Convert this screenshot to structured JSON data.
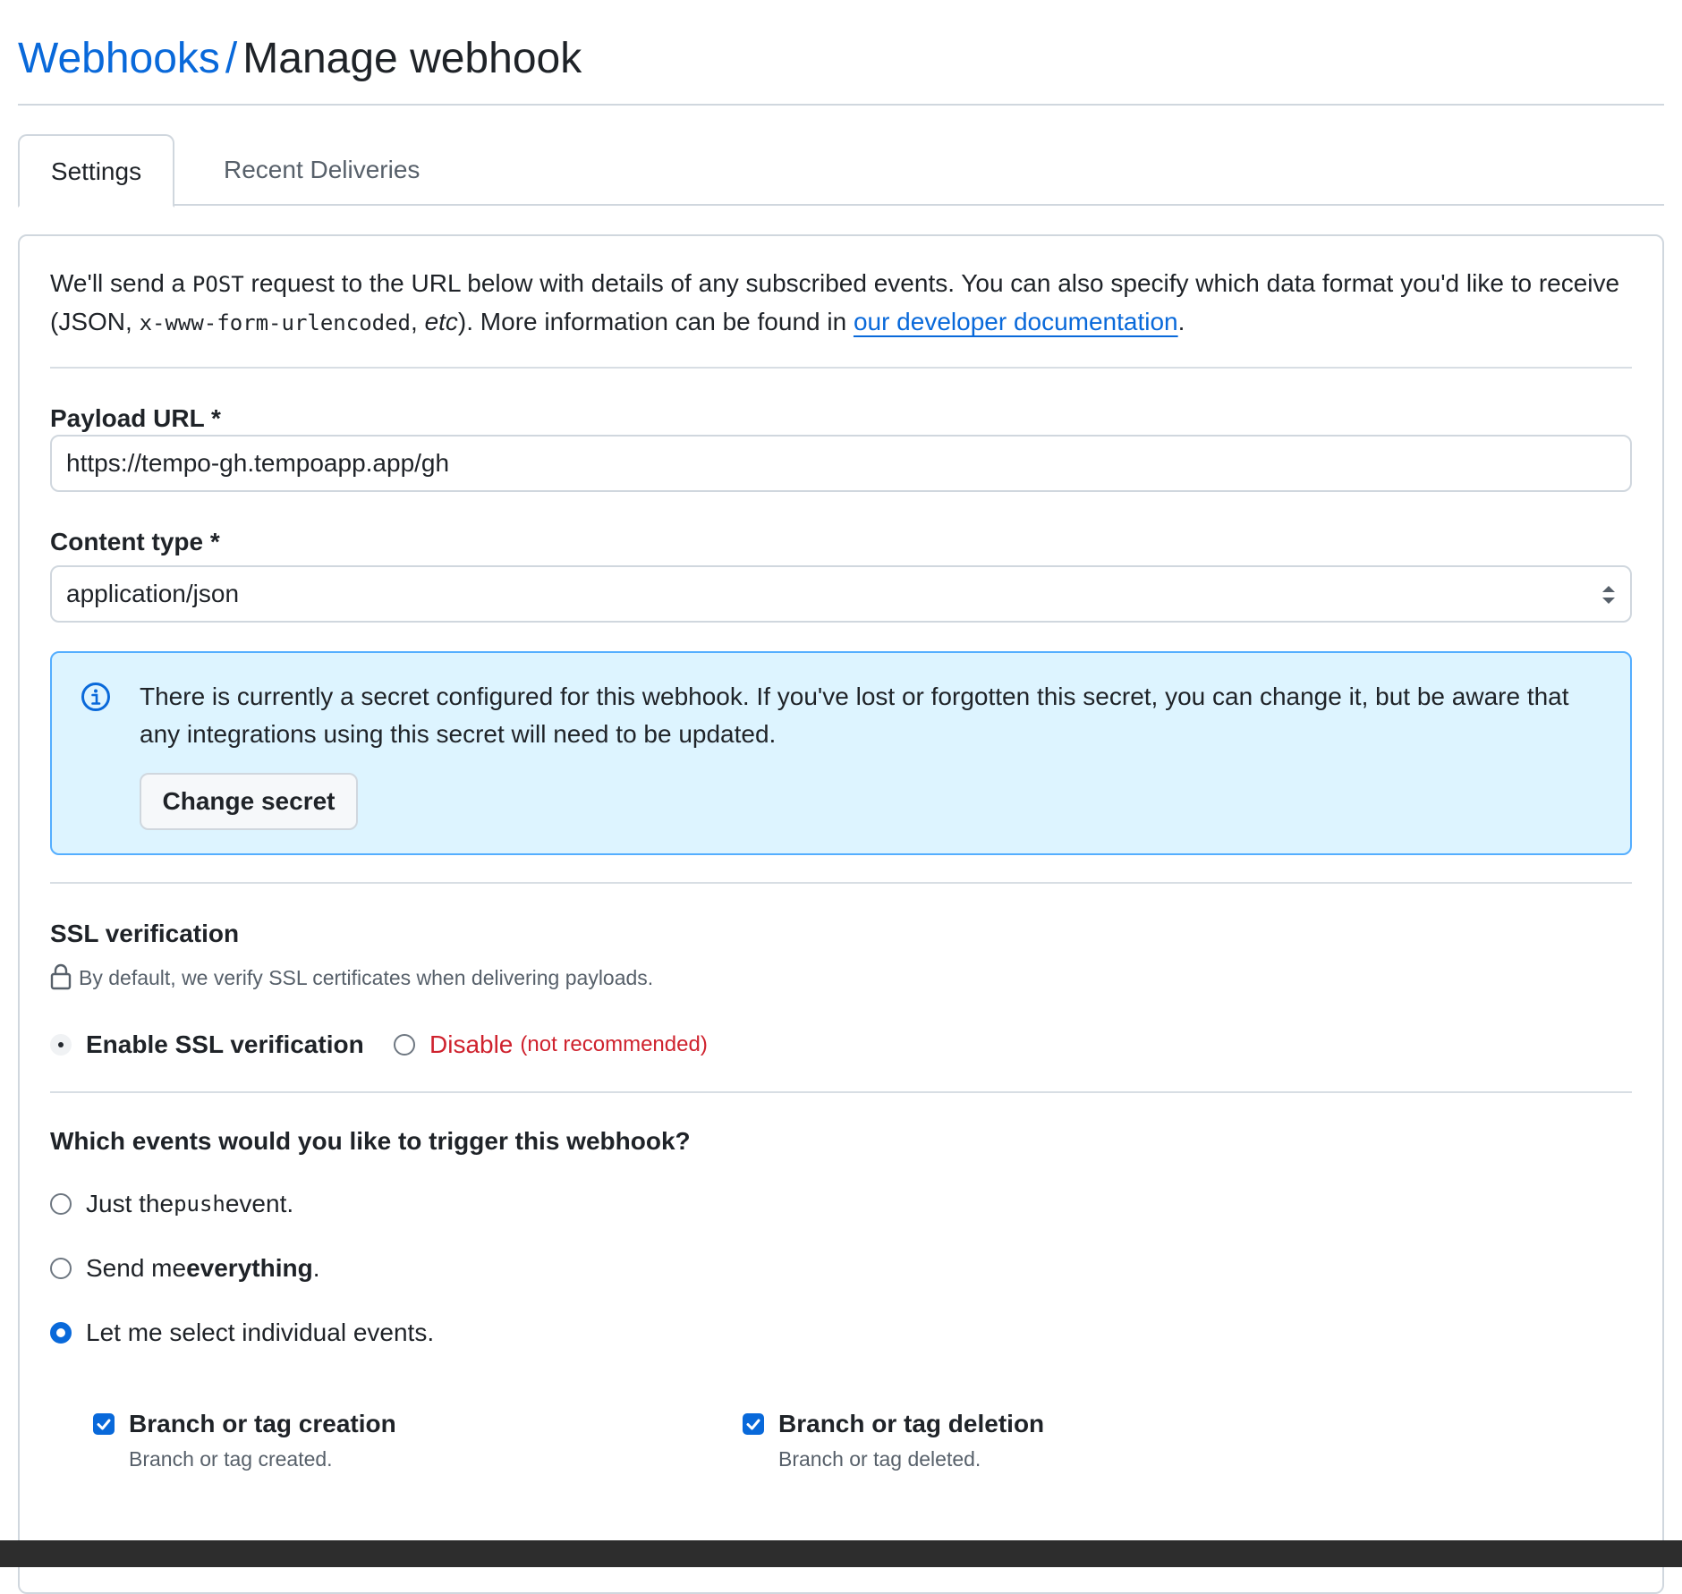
{
  "header": {
    "breadcrumb_link": "Webhooks",
    "separator": "/",
    "title": "Manage webhook"
  },
  "tabs": [
    {
      "label": "Settings",
      "active": true
    },
    {
      "label": "Recent Deliveries",
      "active": false
    }
  ],
  "intro": {
    "part1": "We'll send a ",
    "code1": "POST",
    "part2": " request to the URL below with details of any subscribed events. You can also specify which data format you'd like to receive (JSON, ",
    "code2": "x-www-form-urlencoded",
    "part3": ", ",
    "etc": "etc",
    "part4": "). More information can be found in ",
    "link": "our developer documentation",
    "part5": "."
  },
  "payload_url": {
    "label": "Payload URL *",
    "value": "https://tempo-gh.tempoapp.app/gh"
  },
  "content_type": {
    "label": "Content type *",
    "selected": "application/json"
  },
  "secret_notice": {
    "text": "There is currently a secret configured for this webhook. If you've lost or forgotten this secret, you can change it, but be aware that any integrations using this secret will need to be updated.",
    "button": "Change secret"
  },
  "ssl": {
    "title": "SSL verification",
    "note": "By default, we verify SSL certificates when delivering payloads.",
    "enable_label": "Enable SSL verification",
    "disable_label": "Disable",
    "disable_note": "(not recommended)",
    "selected": "enable"
  },
  "events": {
    "title": "Which events would you like to trigger this webhook?",
    "options": {
      "push_pre": "Just the ",
      "push_code": "push",
      "push_post": " event.",
      "everything_pre": "Send me ",
      "everything_bold": "everything",
      "everything_post": ".",
      "individual": "Let me select individual events."
    },
    "selected": "individual",
    "items": [
      {
        "title": "Branch or tag creation",
        "desc": "Branch or tag created.",
        "checked": true
      },
      {
        "title": "Branch or tag deletion",
        "desc": "Branch or tag deleted.",
        "checked": true
      }
    ]
  },
  "colors": {
    "link": "#0969da",
    "danger": "#cf222e",
    "info_bg": "#ddf4ff",
    "info_border": "#54aeff"
  }
}
